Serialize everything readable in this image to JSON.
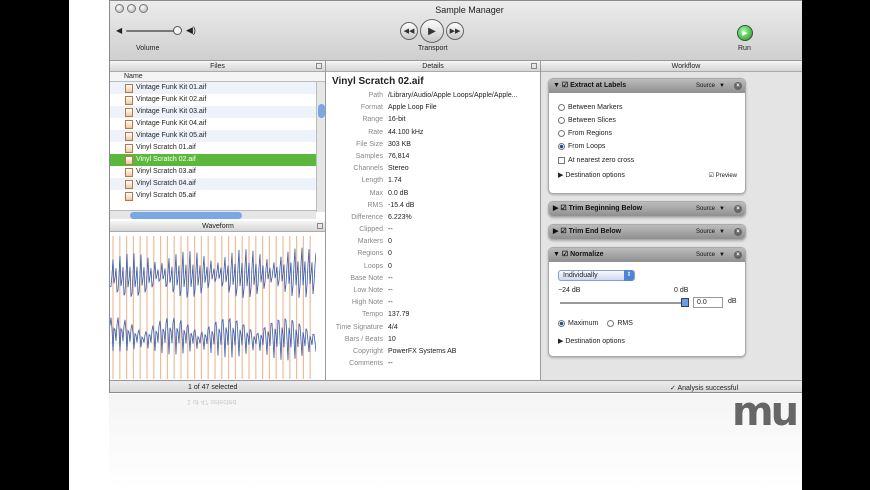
{
  "window": {
    "title": "Sample Manager"
  },
  "toolbar": {
    "volume_label": "Volume",
    "transport_label": "Transport",
    "run_label": "Run"
  },
  "panes": {
    "files": "Files",
    "details": "Details",
    "workflow": "Workflow",
    "waveform": "Waveform"
  },
  "files": {
    "column": "Name",
    "items": [
      "Vintage Funk Kit 01.aif",
      "Vintage Funk Kit 02.aif",
      "Vintage Funk Kit 03.aif",
      "Vintage Funk Kit 04.aif",
      "Vintage Funk Kit 05.aif",
      "Vinyl Scratch 01.aif",
      "Vinyl Scratch 02.aif",
      "Vinyl Scratch 03.aif",
      "Vinyl Scratch 04.aif",
      "Vinyl Scratch 05.aif"
    ],
    "selected_index": 6,
    "status": "1 of 47 selected"
  },
  "details": {
    "title": "Vinyl Scratch 02.aif",
    "rows": [
      {
        "k": "Path",
        "v": "/Library/Audio/Apple Loops/Apple/Apple..."
      },
      {
        "k": "Format",
        "v": "Apple Loop File"
      },
      {
        "k": "Range",
        "v": "16-bit"
      },
      {
        "k": "Rate",
        "v": "44.100 kHz"
      },
      {
        "k": "File Size",
        "v": "303 KB"
      },
      {
        "k": "Samples",
        "v": "76,814"
      },
      {
        "k": "Channels",
        "v": "Stereo"
      },
      {
        "k": "Length",
        "v": "1.74"
      },
      {
        "k": "Max",
        "v": "0.0 dB"
      },
      {
        "k": "RMS",
        "v": "-15.4 dB"
      },
      {
        "k": "Difference",
        "v": "6.223%"
      },
      {
        "k": "Clipped",
        "v": "--"
      },
      {
        "k": "Markers",
        "v": "0"
      },
      {
        "k": "Regions",
        "v": "0"
      },
      {
        "k": "Loops",
        "v": "0"
      },
      {
        "k": "Base Note",
        "v": "--"
      },
      {
        "k": "Low Note",
        "v": "--"
      },
      {
        "k": "High Note",
        "v": "--"
      },
      {
        "k": "Tempo",
        "v": "137.79"
      },
      {
        "k": "Time Signature",
        "v": "4/4"
      },
      {
        "k": "Bars / Beats",
        "v": "10"
      },
      {
        "k": "Copyright",
        "v": "PowerFX Systems AB"
      },
      {
        "k": "Comments",
        "v": "--"
      }
    ]
  },
  "workflow": {
    "source": "Source",
    "extract": {
      "title": "Extract at Labels",
      "options": [
        "Between Markers",
        "Between Slices",
        "From Regions",
        "From Loops"
      ],
      "selected": 3,
      "zero_cross": "At nearest zero cross",
      "dest": "Destination options",
      "preview": "Preview"
    },
    "trim_begin": "Trim Beginning Below",
    "trim_end": "Trim End Below",
    "normalize": {
      "title": "Normalize",
      "mode": "Individually",
      "min_label": "−24 dB",
      "max_label": "0 dB",
      "value": "0.0",
      "unit": "dB",
      "slider_level": 1.0,
      "maximum": "Maximum",
      "rms": "RMS",
      "dest": "Destination options"
    },
    "status": "Analysis successful"
  },
  "colors": {
    "selection": "#5cb83c",
    "waveform": "#3a5aa8",
    "slice": "#e8a070"
  },
  "logo": "mu",
  "icons": [
    "close-light-icon",
    "minimize-light-icon",
    "zoom-light-icon",
    "volume-low-icon",
    "volume-high-icon",
    "rewind-icon",
    "play-icon",
    "fast-forward-icon",
    "run-icon",
    "file-icon",
    "close-icon",
    "disclosure-icon",
    "checkmark-icon"
  ]
}
